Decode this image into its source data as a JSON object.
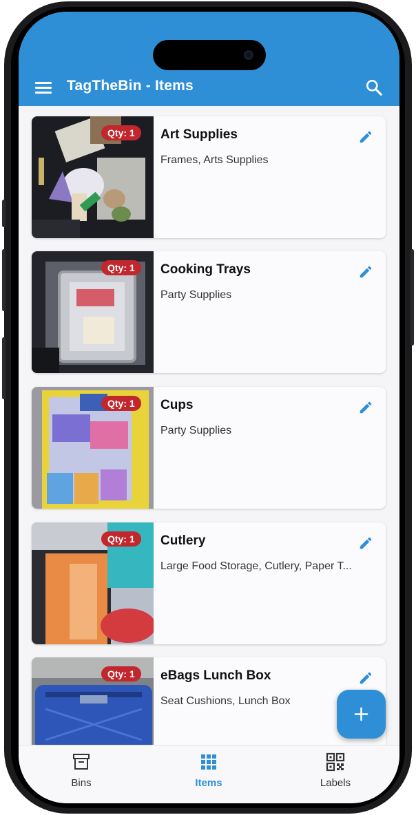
{
  "app": {
    "title": "TagTheBin - Items"
  },
  "items": [
    {
      "title": "Art Supplies",
      "subtitle": "Frames, Arts Supplies",
      "qty": "Qty: 1"
    },
    {
      "title": "Cooking Trays",
      "subtitle": "Party Supplies",
      "qty": "Qty: 1"
    },
    {
      "title": "Cups",
      "subtitle": "Party Supplies",
      "qty": "Qty: 1"
    },
    {
      "title": "Cutlery",
      "subtitle": "Large Food Storage, Cutlery, Paper T...",
      "qty": "Qty: 1"
    },
    {
      "title": "eBags Lunch Box",
      "subtitle": "Seat Cushions, Lunch Box",
      "qty": "Qty: 1"
    }
  ],
  "nav": {
    "bins": "Bins",
    "items": "Items",
    "labels": "Labels",
    "active": "Items"
  },
  "icons": {
    "menu": "menu-icon",
    "search": "search-icon",
    "edit": "pencil-icon",
    "add": "plus-icon",
    "bins": "archive-box-icon",
    "items": "grid-icon",
    "labels": "qr-code-icon"
  },
  "colors": {
    "primary": "#2f8fd6",
    "badge": "#c1272d",
    "background": "#f5f5f8"
  }
}
